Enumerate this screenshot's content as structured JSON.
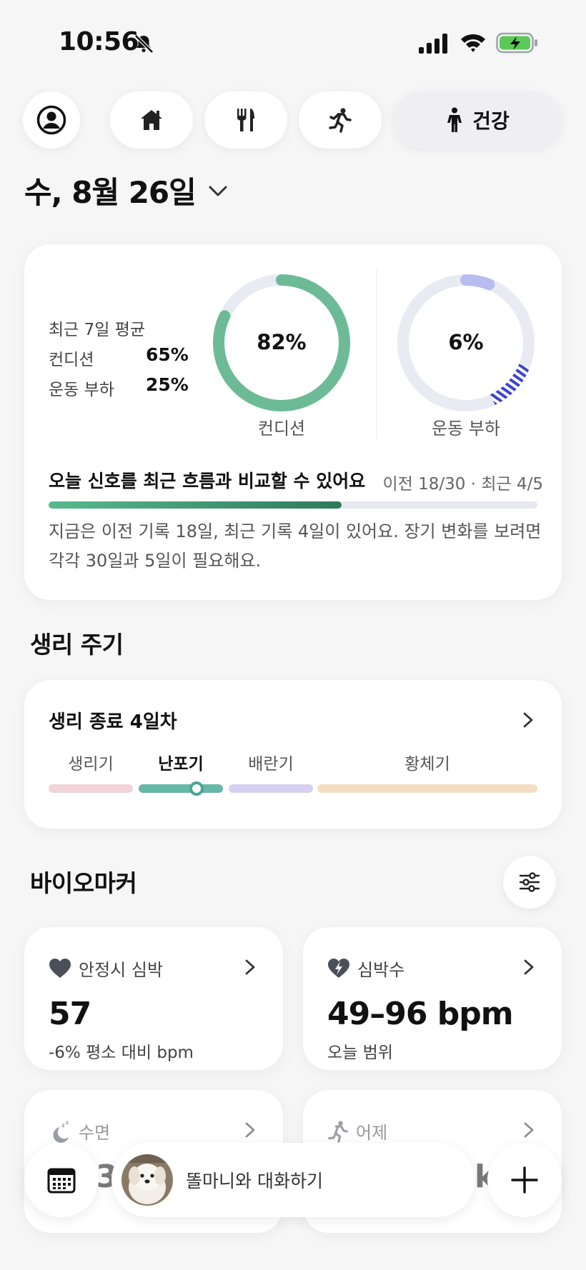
{
  "status_bar": {
    "time": "10:56"
  },
  "nav": {
    "profile_icon": "user-circle-icon",
    "home_icon": "home-icon",
    "food_icon": "fork-knife-icon",
    "exercise_icon": "running-icon",
    "health_label": "건강",
    "health_icon": "standing-person-icon"
  },
  "date": "수, 8월 26일",
  "overview": {
    "avg_title": "최근 7일 평균",
    "avg_condition_label": "컨디션",
    "avg_condition_value": "65%",
    "avg_load_label": "운동 부하",
    "avg_load_value": "25%",
    "condition_ring": {
      "value_text": "82%",
      "fraction": 0.82,
      "label": "컨디션",
      "color": "#6dbb96"
    },
    "load_ring": {
      "value_text": "6%",
      "fraction": 0.06,
      "label": "운동 부하",
      "color": "#b8bdf0",
      "hatch_color": "#3a45c8"
    },
    "compare_title": "오늘 신호를 최근 흐름과 비교할 수 있어요",
    "compare_meta": "이전 18/30 · 최근 4/5",
    "compare_progress": 0.6,
    "compare_desc": "지금은 이전 기록 18일, 최근 기록 4일이 있어요. 장기 변화를 보려면 각각 30일과 5일이 필요해요."
  },
  "cycle": {
    "section_title": "생리 주기",
    "status": "생리 종료 4일차",
    "phases": [
      {
        "label": "생리기",
        "color": "#f1d3db",
        "active": false
      },
      {
        "label": "난포기",
        "color": "#67b8a9",
        "active": true
      },
      {
        "label": "배란기",
        "color": "#d6d1f2",
        "active": false
      },
      {
        "label": "황체기",
        "color": "#f2dfc2",
        "active": false
      }
    ]
  },
  "biomarkers": {
    "section_title": "바이오마커",
    "filter_icon": "sliders-icon",
    "cards": [
      {
        "icon": "heart-icon",
        "label": "안정시 심박",
        "value": "57",
        "sub": "-6% 평소 대비 bpm"
      },
      {
        "icon": "heart-bolt-icon",
        "label": "심박수",
        "value": "49–96 bpm",
        "sub": "오늘 범위"
      },
      {
        "icon": "moon-sleep-icon",
        "label": "수면",
        "value": "3",
        "sub": ""
      },
      {
        "icon": "running-icon",
        "label": "어제",
        "value": "kc",
        "sub": ""
      }
    ]
  },
  "bottom_bar": {
    "calendar_icon": "calendar-icon",
    "chat_placeholder": "똘마니와 대화하기",
    "add_icon": "plus-icon"
  }
}
